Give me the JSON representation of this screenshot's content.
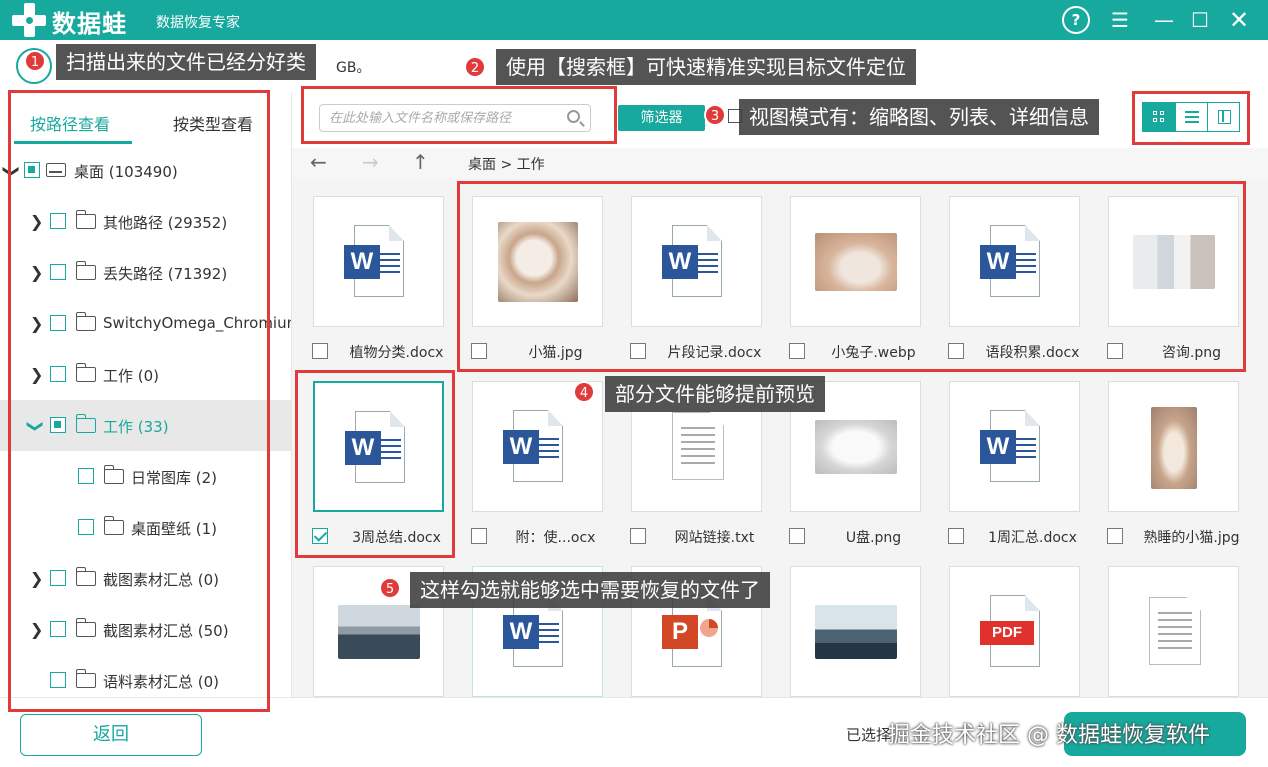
{
  "app": {
    "name": "数据蛙",
    "subtitle": "数据恢复专家",
    "help_glyph": "?",
    "menu_glyph": "☰",
    "min_glyph": "—",
    "max_glyph": "☐",
    "close_glyph": "✕"
  },
  "scan_info": {
    "text": "GB。"
  },
  "left_panel": {
    "tabs": [
      {
        "label": "按路径查看",
        "active": true
      },
      {
        "label": "按类型查看",
        "active": false
      }
    ],
    "tree": [
      {
        "label": "桌面 (103490)",
        "level": 0,
        "type": "drive",
        "state": "partial",
        "chevron": "down"
      },
      {
        "label": "其他路径 (29352)",
        "level": 1,
        "type": "folder",
        "state": "none",
        "chevron": "right"
      },
      {
        "label": "丢失路径 (71392)",
        "level": 1,
        "type": "folder",
        "state": "none",
        "chevron": "right"
      },
      {
        "label": "SwitchyOmega_Chromium",
        "level": 1,
        "type": "folder",
        "state": "none",
        "chevron": "right"
      },
      {
        "label": "工作 (0)",
        "level": 1,
        "type": "folder",
        "state": "none",
        "chevron": "right"
      },
      {
        "label": "工作 (33)",
        "level": 1,
        "type": "folder",
        "state": "partial",
        "chevron": "down",
        "selected": true
      },
      {
        "label": "日常图库 (2)",
        "level": 2,
        "type": "folder",
        "state": "none"
      },
      {
        "label": "桌面壁纸 (1)",
        "level": 2,
        "type": "folder",
        "state": "none"
      },
      {
        "label": "截图素材汇总 (0)",
        "level": 1,
        "type": "folder",
        "state": "none",
        "chevron": "right"
      },
      {
        "label": "截图素材汇总 (50)",
        "level": 1,
        "type": "folder",
        "state": "none",
        "chevron": "right"
      },
      {
        "label": "语料素材汇总 (0)",
        "level": 1,
        "type": "folder",
        "state": "none"
      }
    ]
  },
  "toolbar": {
    "search_placeholder": "在此处输入文件名称或保存路径",
    "filter_label": "筛选器",
    "view_modes": [
      "thumbnail",
      "list",
      "detail"
    ],
    "active_view": "thumbnail"
  },
  "nav": {
    "back_glyph": "←",
    "forward_glyph": "→",
    "up_glyph": "↑",
    "breadcrumb": "桌面 > 工作"
  },
  "files": [
    {
      "name": "植物分类.docx",
      "kind": "word",
      "checked": false
    },
    {
      "name": "小猫.jpg",
      "kind": "photo-cat",
      "checked": false
    },
    {
      "name": "片段记录.docx",
      "kind": "word",
      "checked": false
    },
    {
      "name": "小兔子.webp",
      "kind": "photo-rabbit",
      "checked": false
    },
    {
      "name": "语段积累.docx",
      "kind": "word",
      "checked": false
    },
    {
      "name": "咨询.png",
      "kind": "photo-meeting",
      "checked": false
    },
    {
      "name": "3周总结.docx",
      "kind": "word",
      "checked": true
    },
    {
      "name": "附：使...ocx",
      "kind": "word",
      "checked": false
    },
    {
      "name": "网站链接.txt",
      "kind": "txt",
      "checked": false
    },
    {
      "name": "U盘.png",
      "kind": "photo-usb",
      "checked": false
    },
    {
      "name": "1周汇总.docx",
      "kind": "word",
      "checked": false
    },
    {
      "name": "熟睡的小猫.jpg",
      "kind": "photo-kitten",
      "checked": false
    },
    {
      "name": "",
      "kind": "photo-laptop"
    },
    {
      "name": "",
      "kind": "word"
    },
    {
      "name": "",
      "kind": "ppt"
    },
    {
      "name": "",
      "kind": "photo-desk"
    },
    {
      "name": "",
      "kind": "pdf"
    },
    {
      "name": "",
      "kind": "txt"
    }
  ],
  "icons": {
    "word_letter": "W",
    "ppt_letter": "P",
    "pdf_label": "PDF"
  },
  "footer": {
    "back_label": "返回",
    "selected_text": "已选择",
    "watermark": "掘金技术社区 @ 数据蛙恢复软件"
  },
  "annotations": [
    {
      "num": "1",
      "text": "扫描出来的文件已经分好类"
    },
    {
      "num": "2",
      "text": "使用【搜索框】可快速精准实现目标文件定位"
    },
    {
      "num": "3",
      "text": "视图模式有：缩略图、列表、详细信息"
    },
    {
      "num": "4",
      "text": "部分文件能够提前预览"
    },
    {
      "num": "5",
      "text": "这样勾选就能够选中需要恢复的文件了"
    }
  ],
  "colors": {
    "brand": "#17a99e",
    "annotation_red": "#e03b3b",
    "word_blue": "#2b579a",
    "ppt_red": "#d24726",
    "pdf_red": "#e0312d"
  }
}
